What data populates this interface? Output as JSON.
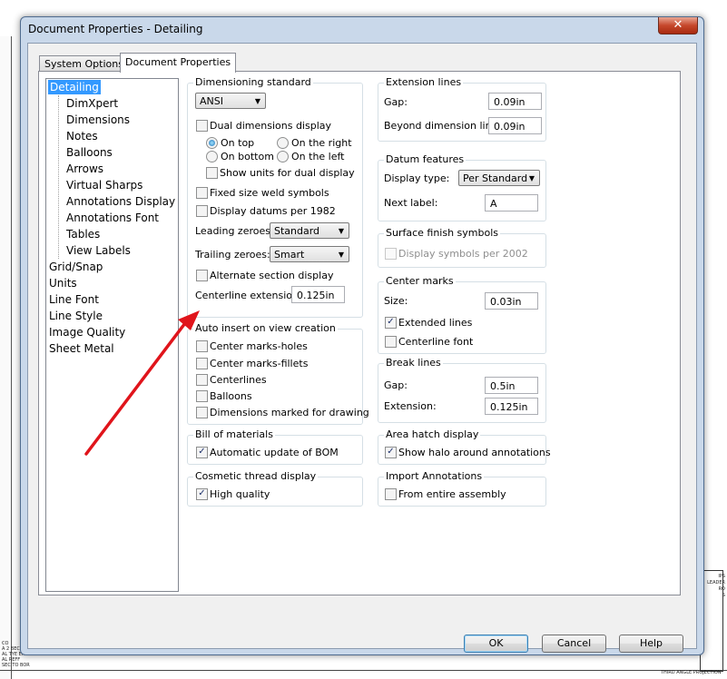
{
  "window": {
    "title": "Document Properties - Detailing",
    "close_glyph": "✕"
  },
  "tabs": [
    {
      "label": "System Options"
    },
    {
      "label": "Document Properties"
    }
  ],
  "tree": {
    "items": [
      "Detailing",
      "DimXpert",
      "Dimensions",
      "Notes",
      "Balloons",
      "Arrows",
      "Virtual Sharps",
      "Annotations Display",
      "Annotations Font",
      "Tables",
      "View Labels",
      "Grid/Snap",
      "Units",
      "Line Font",
      "Line Style",
      "Image Quality",
      "Sheet Metal"
    ],
    "selected": "Detailing"
  },
  "dimensioning": {
    "title": "Dimensioning standard",
    "standard": "ANSI",
    "dual_display": "Dual dimensions display",
    "on_top": "On top",
    "on_right": "On the right",
    "on_bottom": "On bottom",
    "on_left": "On the left",
    "show_units": "Show units for dual display",
    "fixed_weld": "Fixed size weld symbols",
    "datums_1982": "Display datums per 1982",
    "leading_label": "Leading zeroes:",
    "leading_value": "Standard",
    "trailing_label": "Trailing zeroes:",
    "trailing_value": "Smart",
    "alt_section": "Alternate section display",
    "centerline_label": "Centerline extension:",
    "centerline_value": "0.125in"
  },
  "auto_insert": {
    "title": "Auto insert on view creation",
    "center_holes": "Center marks-holes",
    "center_fillets": "Center marks-fillets",
    "centerlines": "Centerlines",
    "balloons": "Balloons",
    "dims_marked": "Dimensions marked for drawing"
  },
  "bom": {
    "title": "Bill of materials",
    "auto_update": "Automatic update of BOM"
  },
  "cosmetic": {
    "title": "Cosmetic thread display",
    "high_quality": "High quality"
  },
  "extension": {
    "title": "Extension lines",
    "gap_label": "Gap:",
    "gap_value": "0.09in",
    "beyond_label": "Beyond dimension line:",
    "beyond_value": "0.09in"
  },
  "datum": {
    "title": "Datum features",
    "display_label": "Display type:",
    "display_value": "Per Standard",
    "next_label": "Next label:",
    "next_value": "A"
  },
  "surface": {
    "title": "Surface finish symbols",
    "per2002": "Display symbols per 2002"
  },
  "center_marks": {
    "title": "Center marks",
    "size_label": "Size:",
    "size_value": "0.03in",
    "extended": "Extended lines",
    "font": "Centerline font"
  },
  "break_lines": {
    "title": "Break lines",
    "gap_label": "Gap:",
    "gap_value": "0.5in",
    "extension_label": "Extension:",
    "extension_value": "0.125in"
  },
  "area_hatch": {
    "title": "Area hatch display",
    "halo": "Show halo around annotations"
  },
  "import": {
    "title": "Import Annotations",
    "entire": "From entire assembly"
  },
  "buttons": {
    "ok": "OK",
    "cancel": "Cancel",
    "help": "Help"
  },
  "glyphs": {
    "check": "✓",
    "dropdown": "▼"
  },
  "colors": {
    "selection": "#3399ff",
    "annotation_arrow": "#e0141b",
    "window_frame": "#c9d8ea"
  },
  "background": {
    "corner_text": "CO\nA 2 BECU\nAL TYE ERC\nAL REFF\nSEC TO BOR",
    "right_text": "IPS\nLEADER\nRO\nS",
    "footer_text": "THIRD ANGLE PROJECTION"
  }
}
